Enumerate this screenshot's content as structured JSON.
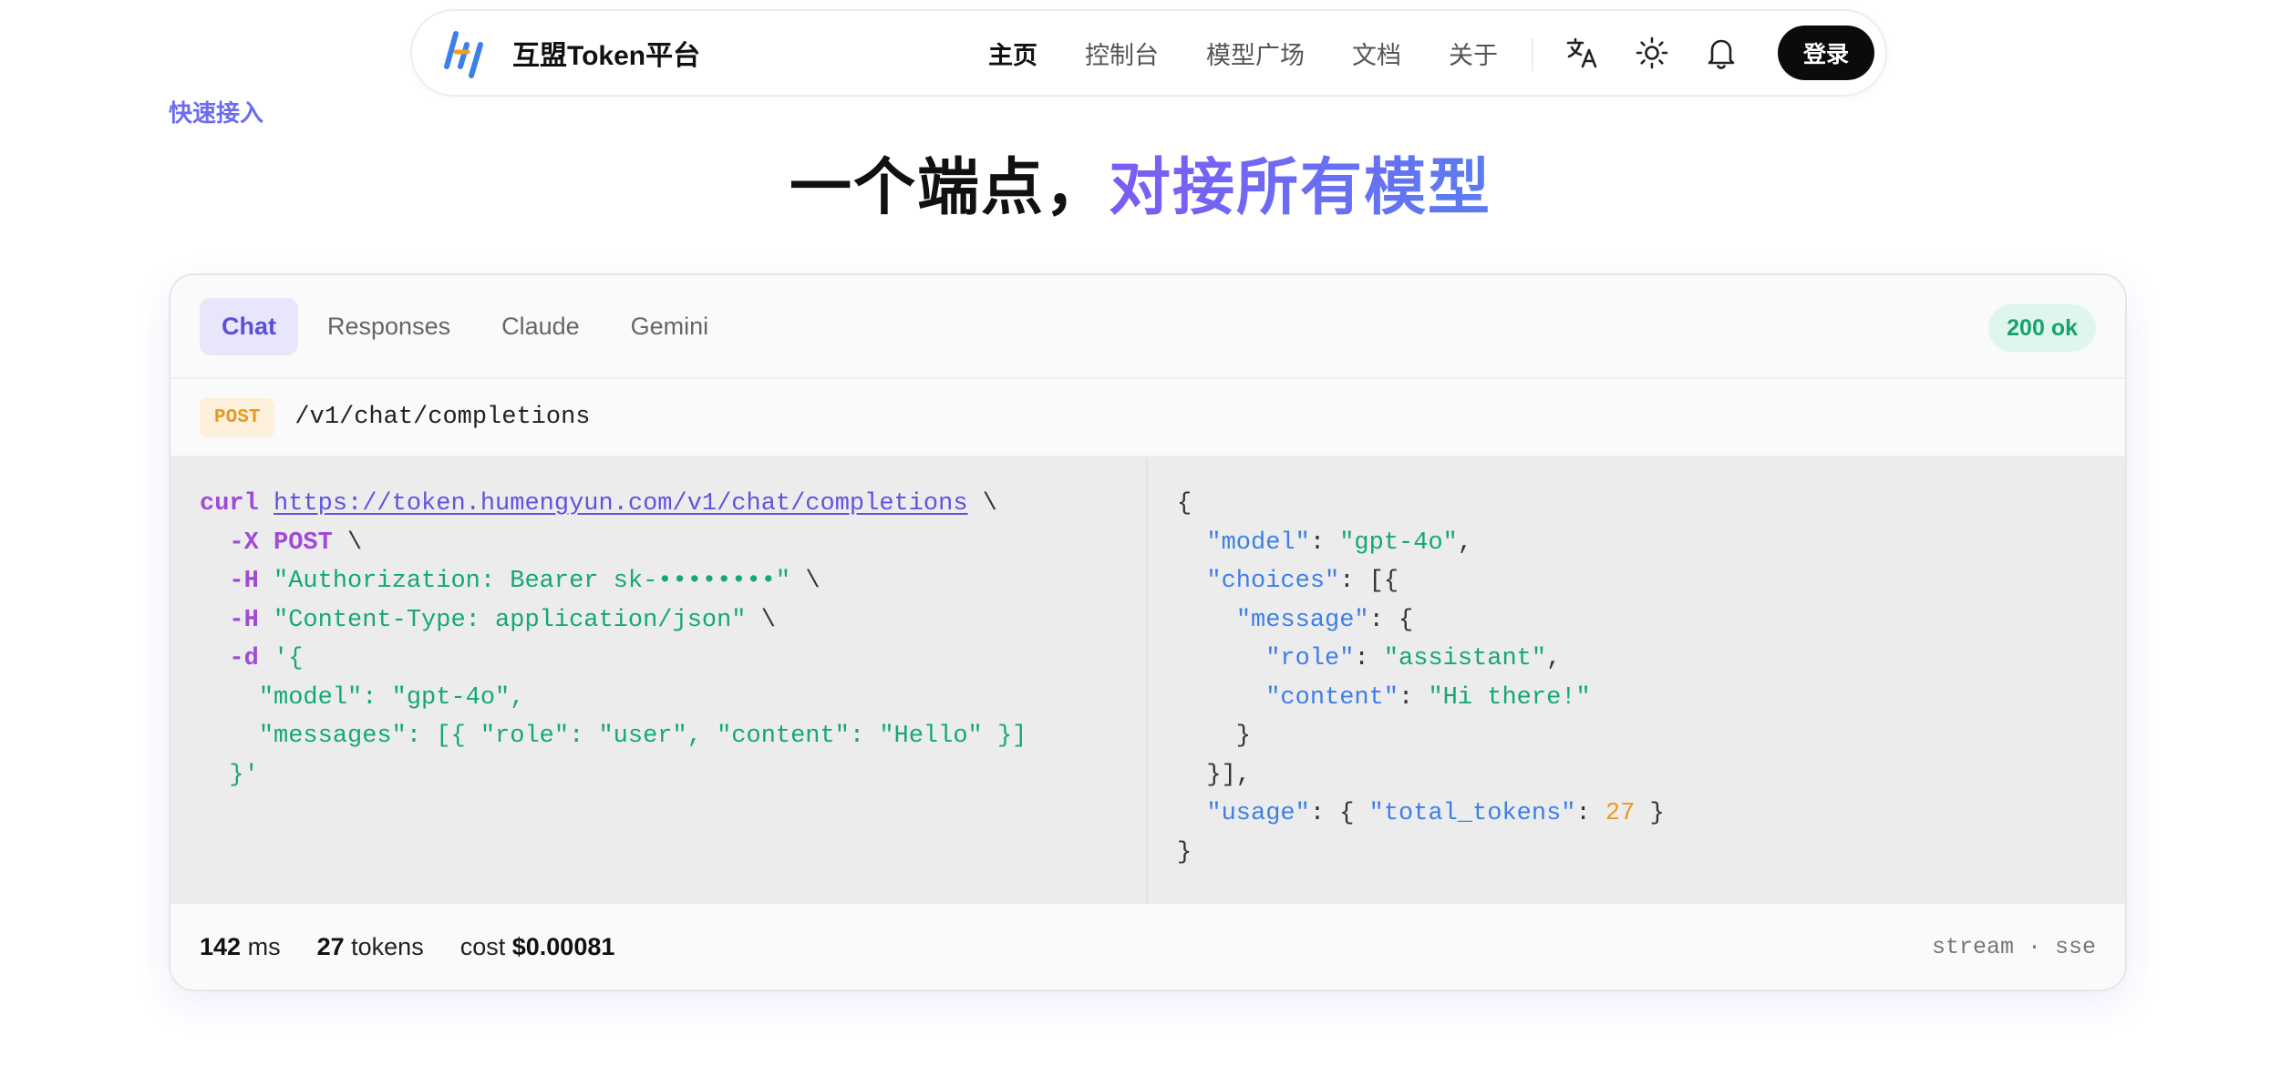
{
  "brand": {
    "name": "互盟Token平台",
    "logo_icon": "brand-logo-icon",
    "colors": [
      "#3d7fe8",
      "#f0a020"
    ]
  },
  "nav": {
    "links": [
      {
        "label": "主页",
        "active": true
      },
      {
        "label": "控制台",
        "active": false
      },
      {
        "label": "模型广场",
        "active": false
      },
      {
        "label": "文档",
        "active": false
      },
      {
        "label": "关于",
        "active": false
      }
    ],
    "icons": [
      "translate-icon",
      "theme-sun-icon",
      "notification-bell-icon"
    ],
    "login_label": "登录"
  },
  "section_tag": "快速接入",
  "hero": {
    "title_plain": "一个端点，",
    "title_accent": "对接所有模型",
    "accent_colors": [
      "#7c5cf4",
      "#5b7cf0"
    ]
  },
  "card": {
    "tabs": [
      {
        "label": "Chat",
        "active": true
      },
      {
        "label": "Responses",
        "active": false
      },
      {
        "label": "Claude",
        "active": false
      },
      {
        "label": "Gemini",
        "active": false
      }
    ],
    "status": "200 ok",
    "method": "POST",
    "endpoint": "/v1/chat/completions",
    "request": {
      "cmd": "curl",
      "url": "https://token.humengyun.com/v1/chat/completions",
      "continuation": "\\",
      "flag_x": "-X",
      "method": "POST",
      "flag_h": "-H",
      "header_auth": "\"Authorization: Bearer sk-••••••••\"",
      "header_ct": "\"Content-Type: application/json\"",
      "flag_d": "-d",
      "body_open": "'{",
      "body_model": "\"model\": \"gpt-4o\",",
      "body_messages": "\"messages\": [{ \"role\": \"user\", \"content\": \"Hello\" }]",
      "body_close": "}'"
    },
    "response": {
      "open": "{",
      "model_key": "\"model\"",
      "model_val": "\"gpt-4o\"",
      "choices_key": "\"choices\"",
      "message_key": "\"message\"",
      "role_key": "\"role\"",
      "role_val": "\"assistant\"",
      "content_key": "\"content\"",
      "content_val": "\"Hi there!\"",
      "usage_key": "\"usage\"",
      "total_tokens_key": "\"total_tokens\"",
      "total_tokens_val": "27",
      "close": "}"
    },
    "footer": {
      "latency_value": "142",
      "latency_unit": "ms",
      "tokens_value": "27",
      "tokens_unit": "tokens",
      "cost_label": "cost",
      "cost_value": "$0.00081",
      "stream": "stream · sse"
    }
  }
}
